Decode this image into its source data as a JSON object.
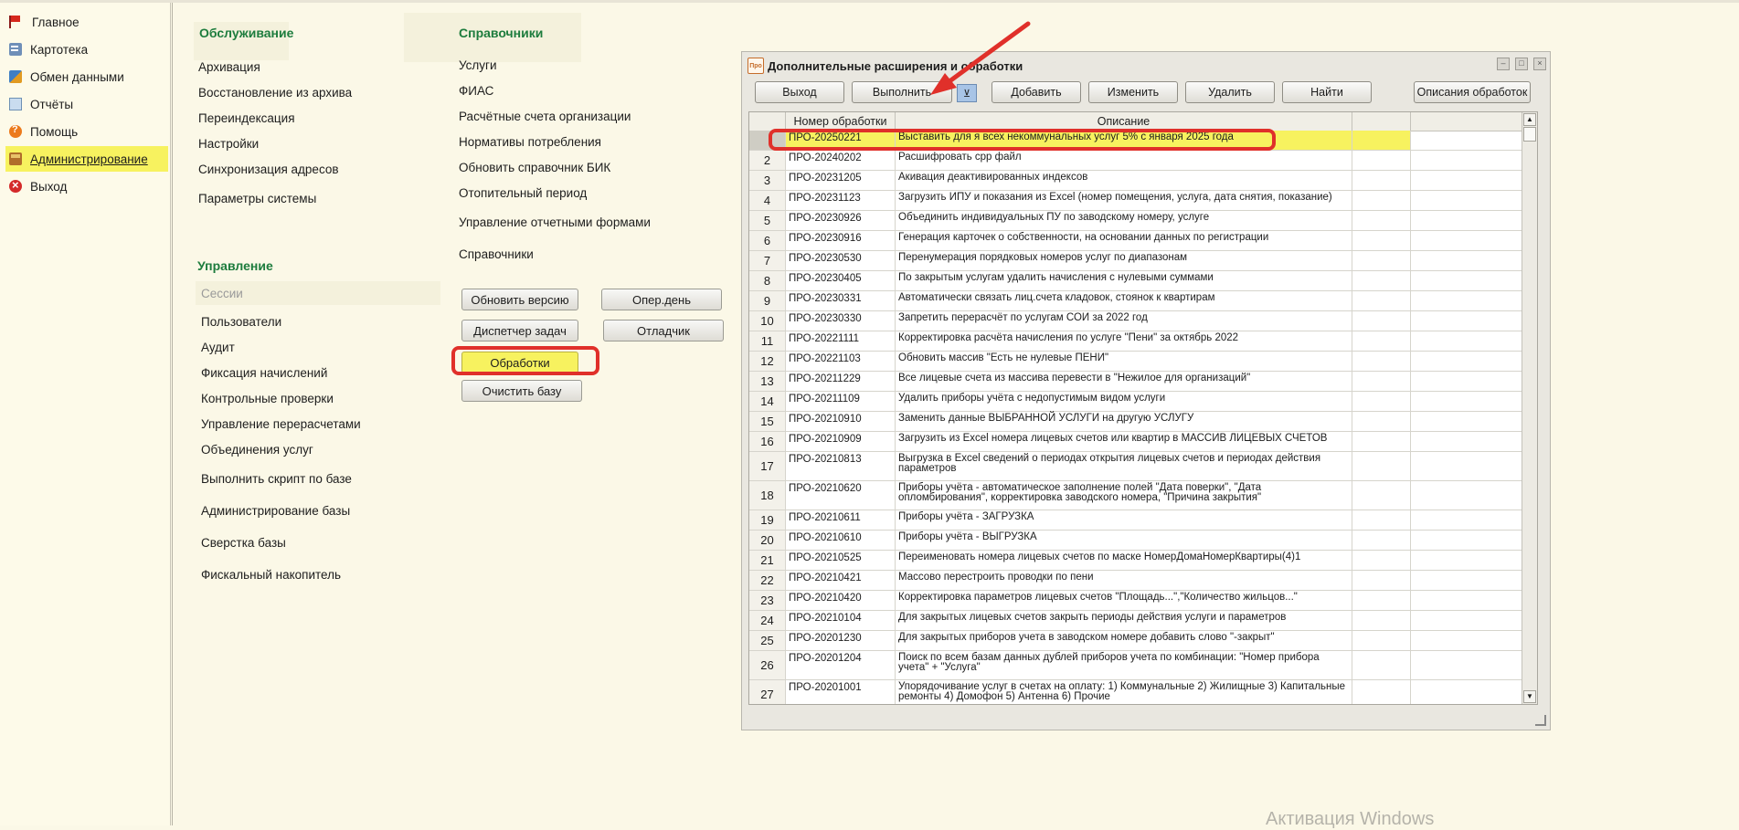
{
  "sidebar": {
    "items": [
      {
        "label": "Главное"
      },
      {
        "label": "Картотека"
      },
      {
        "label": "Обмен данными"
      },
      {
        "label": "Отчёты"
      },
      {
        "label": "Помощь"
      },
      {
        "label": "Администрирование"
      },
      {
        "label": "Выход"
      }
    ]
  },
  "service": {
    "title": "Обслуживание",
    "links": [
      "Архивация",
      "Восстановление из архива",
      "Переиндексация",
      "Настройки",
      "Синхронизация адресов",
      "Параметры системы"
    ]
  },
  "refs": {
    "title": "Справочники",
    "links": [
      "Услуги",
      "ФИАС",
      "Расчётные счета организации",
      "Нормативы потребления",
      "Обновить справочник БИК",
      "Отопительный период",
      "Управление отчетными формами",
      "Справочники"
    ]
  },
  "manage": {
    "title": "Управление",
    "links": [
      "Сессии",
      "Пользователи",
      "Аудит",
      "Фиксация начислений",
      "Контрольные проверки",
      "Управление перерасчетами",
      "Объединения услуг",
      "Выполнить скрипт по базе",
      "Администрирование базы",
      "Сверстка базы",
      "Фискальный накопитель"
    ]
  },
  "buttons": {
    "update_version": "Обновить версию",
    "oper_day": "Опер.день",
    "task_manager": "Диспетчер задач",
    "debugger": "Отладчик",
    "processing": "Обработки",
    "clear_db": "Очистить базу"
  },
  "window": {
    "logo": "Про",
    "title": "Дополнительные расширения и обработки",
    "toolbar": {
      "exit": "Выход",
      "run": "Выполнить",
      "add": "Добавить",
      "edit": "Изменить",
      "delete": "Удалить",
      "find": "Найти",
      "descriptions": "Описания обработок"
    },
    "columns": {
      "number": "Номер обработки",
      "description": "Описание"
    },
    "rows": [
      {
        "n": "",
        "code": "ПРО-20250221",
        "desc": "Выставить для я всех некоммунальных услуг 5% с января 2025 года"
      },
      {
        "n": "2",
        "code": "ПРО-20240202",
        "desc": "Расшифровать срр файл"
      },
      {
        "n": "3",
        "code": "ПРО-20231205",
        "desc": "Акивация деактивированных индексов"
      },
      {
        "n": "4",
        "code": "ПРО-20231123",
        "desc": "Загрузить ИПУ и показания из Excel (номер помещения,  услуга, дата снятия, показание)"
      },
      {
        "n": "5",
        "code": "ПРО-20230926",
        "desc": "Объединить индивидуальных ПУ по заводскому номеру, услуге"
      },
      {
        "n": "6",
        "code": "ПРО-20230916",
        "desc": "Генерация карточек о собственности, на основании данных по регистрации"
      },
      {
        "n": "7",
        "code": "ПРО-20230530",
        "desc": "Перенумерация порядковых номеров услуг по диапазонам"
      },
      {
        "n": "8",
        "code": "ПРО-20230405",
        "desc": "По закрытым услугам удалить начисления с нулевыми суммами"
      },
      {
        "n": "9",
        "code": "ПРО-20230331",
        "desc": "Автоматически связать лиц.счета кладовок, стоянок к квартирам"
      },
      {
        "n": "10",
        "code": "ПРО-20230330",
        "desc": "Запретить перерасчёт по услугам СОИ за 2022 год"
      },
      {
        "n": "11",
        "code": "ПРО-20221111",
        "desc": "Корректировка расчёта начисления по услуге \"Пени\" за октябрь 2022"
      },
      {
        "n": "12",
        "code": "ПРО-20221103",
        "desc": "Обновить массив \"Есть не нулевые ПЕНИ\""
      },
      {
        "n": "13",
        "code": "ПРО-20211229",
        "desc": "Все лицевые счета из массива перевести в \"Нежилое для организаций\""
      },
      {
        "n": "14",
        "code": "ПРО-20211109",
        "desc": "Удалить приборы учёта с недопустимым видом услуги"
      },
      {
        "n": "15",
        "code": "ПРО-20210910",
        "desc": "Заменить данные ВЫБРАННОЙ УСЛУГИ на другую УСЛУГУ"
      },
      {
        "n": "16",
        "code": "ПРО-20210909",
        "desc": "Загрузить из Excel номера лицевых счетов или квартир в МАССИВ ЛИЦЕВЫХ СЧЕТОВ"
      },
      {
        "n": "17",
        "code": "ПРО-20210813",
        "desc": "Выгрузка в Excel сведений о периодах открытия лицевых счетов и периодах действия параметров"
      },
      {
        "n": "18",
        "code": "ПРО-20210620",
        "desc": "Приборы учёта - автоматическое заполнение полей \"Дата поверки\", \"Дата опломбирования\", корректировка заводского номера, \"Причина закрытия\""
      },
      {
        "n": "19",
        "code": "ПРО-20210611",
        "desc": "Приборы учёта - ЗАГРУЗКА"
      },
      {
        "n": "20",
        "code": "ПРО-20210610",
        "desc": "Приборы учёта - ВЫГРУЗКА"
      },
      {
        "n": "21",
        "code": "ПРО-20210525",
        "desc": "Переименовать номера лицевых счетов по маске НомерДомаНомерКвартиры(4)1"
      },
      {
        "n": "22",
        "code": "ПРО-20210421",
        "desc": "Массово перестроить проводки по пени"
      },
      {
        "n": "23",
        "code": "ПРО-20210420",
        "desc": "Корректировка параметров лицевых счетов \"Площадь...\",\"Количество жильцов...\""
      },
      {
        "n": "24",
        "code": "ПРО-20210104",
        "desc": "Для закрытых лицевых счетов закрыть периоды действия услуги и параметров"
      },
      {
        "n": "25",
        "code": "ПРО-20201230",
        "desc": "Для закрытых приборов учета в заводском номере добавить слово \"-закрыт\""
      },
      {
        "n": "26",
        "code": "ПРО-20201204",
        "desc": "Поиск по всем базам данных дублей приборов учета по комбинации: \"Номер прибора учета\" + \"Услуга\""
      },
      {
        "n": "27",
        "code": "ПРО-20201001",
        "desc": "Упорядочивание услуг в счетах на оплату: 1) Коммунальные  2) Жилищные 3) Капитальные ремонты 4) Домофон 5) Антенна 6) Прочие"
      }
    ]
  },
  "watermark": "Активация Windows",
  "colors": {
    "accent_green": "#1d7c3d",
    "highlight_yellow": "#f7f25f",
    "annotation_red": "#e0302a"
  }
}
